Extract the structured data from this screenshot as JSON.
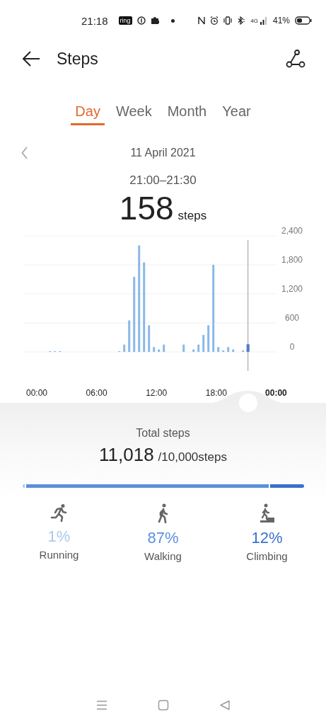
{
  "status_bar": {
    "time": "21:18",
    "app_badge": "ring",
    "network": "4G",
    "battery": "41%"
  },
  "header": {
    "title": "Steps"
  },
  "tabs": [
    {
      "label": "Day",
      "selected": true
    },
    {
      "label": "Week",
      "selected": false
    },
    {
      "label": "Month",
      "selected": false
    },
    {
      "label": "Year",
      "selected": false
    }
  ],
  "date": "11 April 2021",
  "selection": {
    "time_range": "21:00–21:30",
    "value": "158",
    "unit": "steps"
  },
  "chart": {
    "chart_data": {
      "type": "bar",
      "grid": true,
      "x": [
        1,
        1.5,
        2,
        8,
        8.5,
        9,
        9.5,
        10,
        10.5,
        11,
        11.5,
        12,
        12.5,
        14.5,
        15.5,
        16,
        16.5,
        17,
        17.5,
        18,
        18.5,
        19,
        19.5,
        20.5,
        21
      ],
      "series": [
        {
          "color": "#8ab8ea",
          "values": [
            10,
            10,
            10,
            10,
            150,
            650,
            1550,
            2200,
            1850,
            550,
            100,
            50,
            150,
            150,
            50,
            150,
            350,
            550,
            1800,
            100,
            30,
            100,
            50,
            30,
            null
          ]
        },
        {
          "color": "#2d6ccf",
          "values": [
            null,
            null,
            null,
            null,
            null,
            null,
            null,
            null,
            null,
            null,
            null,
            null,
            null,
            null,
            null,
            null,
            null,
            null,
            null,
            null,
            null,
            null,
            null,
            null,
            158
          ]
        }
      ],
      "xlim": [
        0,
        24
      ],
      "ylim": [
        0,
        2400
      ],
      "ref_lines": [
        {
          "axis": "x",
          "value": 21
        }
      ],
      "xticks": [
        {
          "value": 0,
          "label": "00:00"
        },
        {
          "value": 6,
          "label": "06:00"
        },
        {
          "value": 12,
          "label": "12:00"
        },
        {
          "value": 18,
          "label": "18:00"
        },
        {
          "value": 24,
          "label": "00:00"
        }
      ],
      "yticks": [
        {
          "value": 0,
          "label": "0"
        },
        {
          "value": 600,
          "label": "600"
        },
        {
          "value": 1200,
          "label": "1,200"
        },
        {
          "value": 1800,
          "label": "1,800"
        },
        {
          "value": 2400,
          "label": "2,400"
        }
      ]
    }
  },
  "total": {
    "label": "Total steps",
    "value": "11,018",
    "goal": "/10,000steps"
  },
  "activities": [
    {
      "kind": "running",
      "percent": "1%",
      "label": "Running",
      "color": "#a9c8ec"
    },
    {
      "kind": "walking",
      "percent": "87%",
      "label": "Walking",
      "color": "#5b8fde"
    },
    {
      "kind": "climbing",
      "percent": "12%",
      "label": "Climbing",
      "color": "#3a70cc"
    }
  ]
}
